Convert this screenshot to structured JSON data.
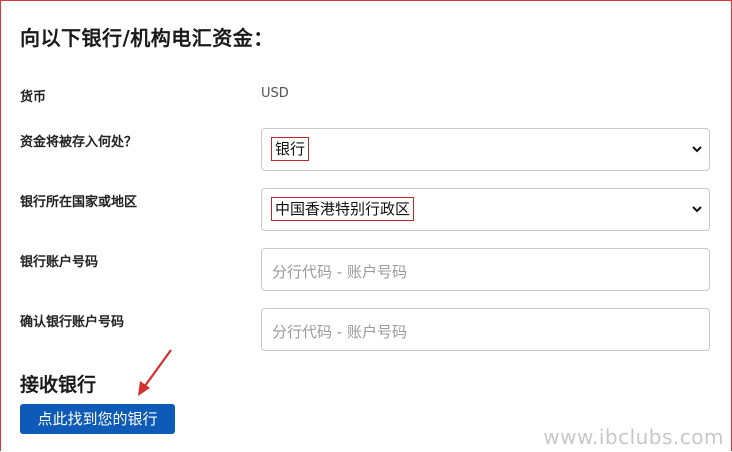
{
  "heading": "向以下银行/机构电汇资金：",
  "rows": {
    "currency": {
      "label": "货币",
      "value": "USD"
    },
    "deposit_target": {
      "label": "资金将被存入何处？",
      "selected": "银行"
    },
    "bank_country": {
      "label": "银行所在国家或地区",
      "selected": "中国香港特别行政区"
    },
    "account_number": {
      "label": "银行账户号码",
      "placeholder": "分行代码 - 账户号码"
    },
    "confirm_account_number": {
      "label": "确认银行账户号码",
      "placeholder": "分行代码 - 账户号码"
    }
  },
  "receiving_bank": {
    "title": "接收银行",
    "button_label": "点此找到您的银行"
  },
  "watermark": "www.ibclubs.com",
  "colors": {
    "button": "#0d5bb6",
    "highlight_box": "#c0262b",
    "annotation_arrow": "#d32f2f"
  },
  "icons": {
    "select_chevron": "chevron-down-icon",
    "annotation": "red-arrow"
  }
}
